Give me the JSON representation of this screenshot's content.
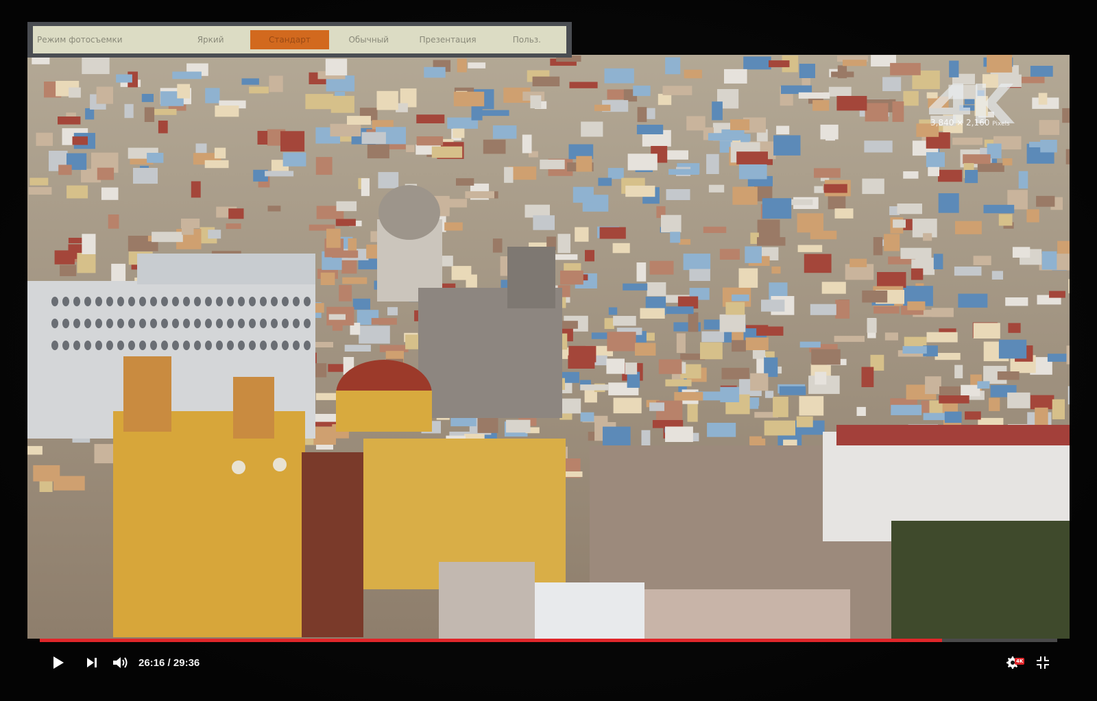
{
  "osd": {
    "title": "Режим фотосъемки",
    "modes": [
      "Яркий",
      "Стандарт",
      "Обычный",
      "Презентация",
      "Польз."
    ],
    "selected_index": 1,
    "selected_color": "#d2691e"
  },
  "video": {
    "watermark_resolution": "3,840 × 2,160",
    "watermark_unit": "Pixels"
  },
  "player": {
    "time_current": "26:16",
    "time_separator": " / ",
    "time_total": "29:36",
    "progress_fraction": 0.887,
    "progress_color": "#e0262a",
    "quality_badge": "4K",
    "icons": {
      "play": "play-icon",
      "next": "next-icon",
      "volume": "volume-icon",
      "settings": "gear-icon",
      "fullscreen_exit": "exit-fullscreen-icon"
    }
  }
}
